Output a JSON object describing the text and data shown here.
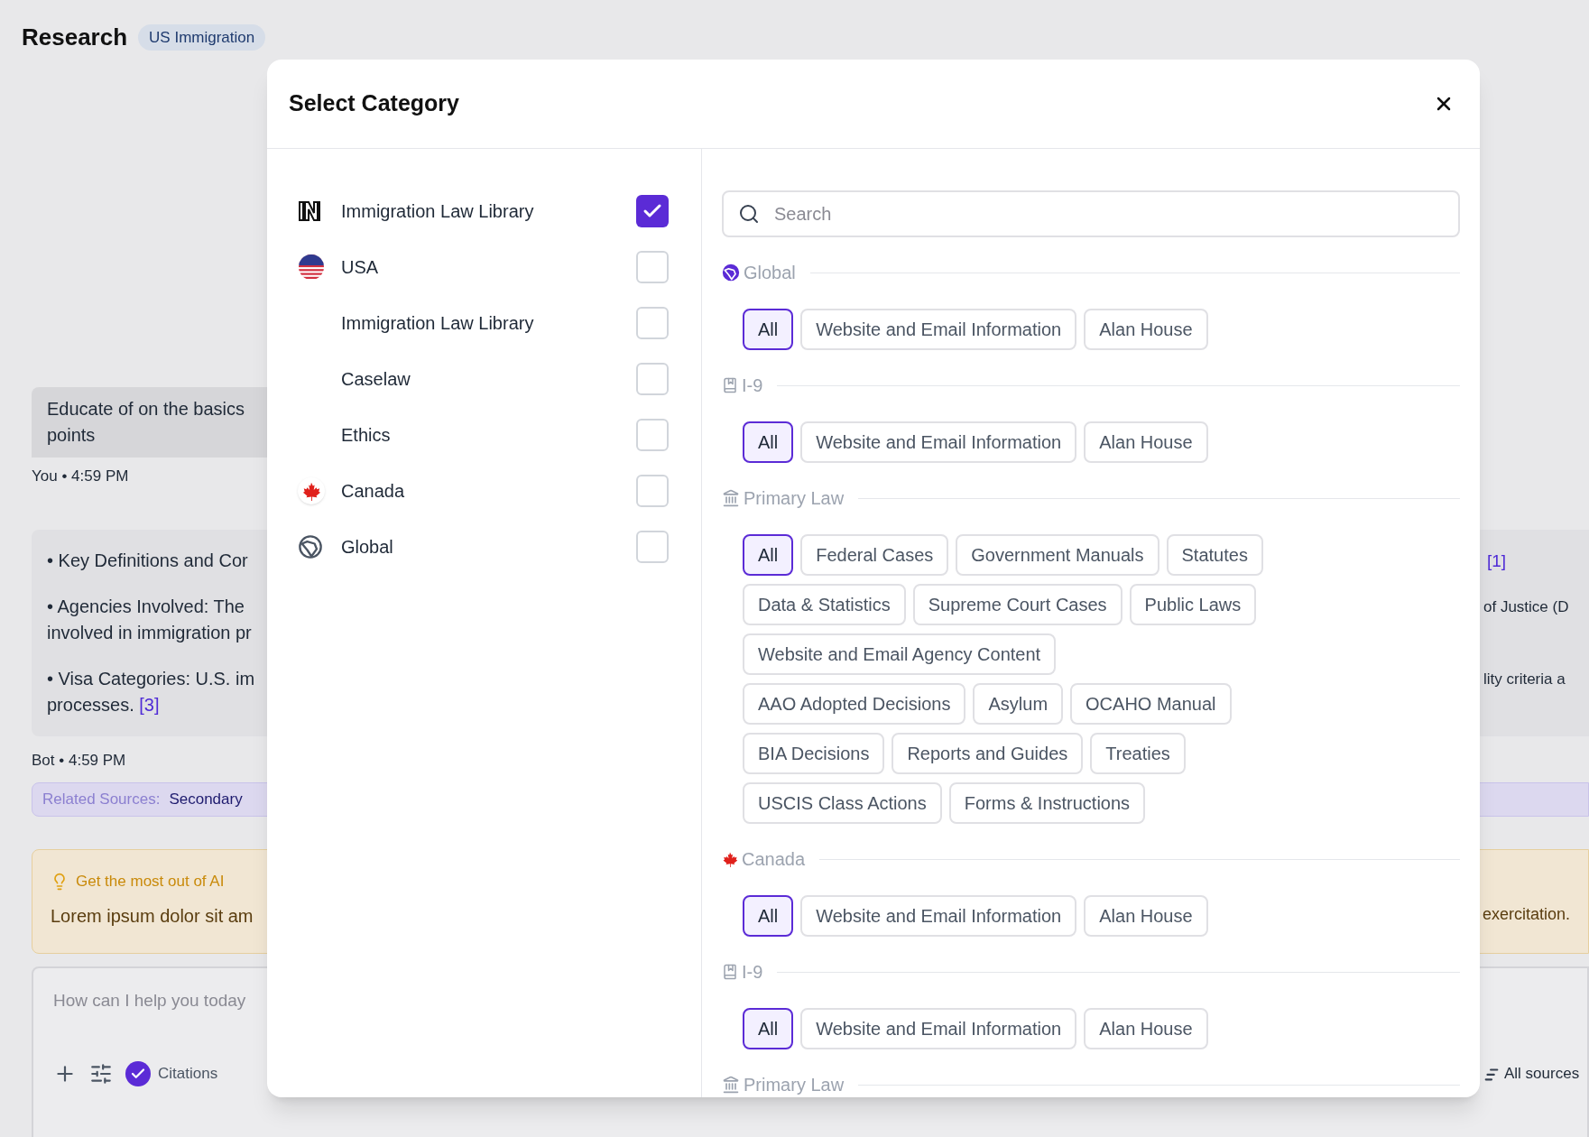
{
  "header": {
    "title": "Research",
    "badge": "US Immigration"
  },
  "user_message": {
    "lines": [
      "Educate of on the basics",
      "points"
    ],
    "sender": "You",
    "separator": "•",
    "time": "4:59 PM"
  },
  "bot_message": {
    "paragraphs": [
      {
        "left": [
          "• Key Definitions and Cor"
        ],
        "right_citation": "[1]"
      },
      {
        "left": [
          "• Agencies Involved: The",
          "involved in immigration pr"
        ],
        "right": "of Justice (D"
      },
      {
        "left": [
          "• Visa Categories: U.S. im",
          "processes."
        ],
        "citation": "[3]",
        "right": "lity criteria a"
      }
    ],
    "sender": "Bot",
    "separator": "•",
    "time": "4:59 PM"
  },
  "related_sources": {
    "label": "Related Sources:",
    "value": "Secondary"
  },
  "tip": {
    "title": "Get the most out of AI",
    "body": "Lorem ipsum dolor sit am",
    "body_right": "exercitation."
  },
  "composer": {
    "placeholder": "How can I help you today",
    "citations": {
      "label": "Citations",
      "checked": true
    },
    "sources_button": "All sources"
  },
  "modal": {
    "title": "Select Category",
    "categories": [
      {
        "label": "Immigration Law Library",
        "kind": "brand",
        "checked": true
      },
      {
        "label": "USA",
        "kind": "usa",
        "checked": false,
        "children": [
          {
            "label": "Immigration Law Library",
            "checked": false
          },
          {
            "label": "Caselaw",
            "checked": false
          },
          {
            "label": "Ethics",
            "checked": false
          }
        ]
      },
      {
        "label": "Canada",
        "kind": "canada",
        "checked": false
      },
      {
        "label": "Global",
        "kind": "global",
        "checked": false
      }
    ],
    "search": {
      "placeholder": "Search"
    },
    "sections": [
      {
        "title": "Global",
        "kind": "global",
        "chip_rows": [
          [
            {
              "label": "All",
              "selected": true
            },
            {
              "label": "Website and Email Information",
              "selected": false
            },
            {
              "label": "Alan House",
              "selected": false
            }
          ]
        ]
      },
      {
        "title": "I-9",
        "kind": "book",
        "chip_rows": [
          [
            {
              "label": "All",
              "selected": true
            },
            {
              "label": "Website and Email Information",
              "selected": false
            },
            {
              "label": "Alan House",
              "selected": false
            }
          ]
        ]
      },
      {
        "title": "Primary Law",
        "kind": "building",
        "chip_rows": [
          [
            {
              "label": "All",
              "selected": true
            },
            {
              "label": "Federal Cases",
              "selected": false
            },
            {
              "label": "Government Manuals",
              "selected": false
            },
            {
              "label": "Statutes",
              "selected": false
            }
          ],
          [
            {
              "label": "Data & Statistics",
              "selected": false
            },
            {
              "label": "Supreme Court Cases",
              "selected": false
            },
            {
              "label": "Public Laws",
              "selected": false
            }
          ],
          [
            {
              "label": "Website and Email Agency Content",
              "selected": false
            }
          ],
          [
            {
              "label": "AAO Adopted Decisions",
              "selected": false
            },
            {
              "label": "Asylum",
              "selected": false
            },
            {
              "label": "OCAHO Manual",
              "selected": false
            }
          ],
          [
            {
              "label": "BIA Decisions",
              "selected": false
            },
            {
              "label": "Reports and Guides",
              "selected": false
            },
            {
              "label": "Treaties",
              "selected": false
            }
          ],
          [
            {
              "label": "USCIS Class Actions",
              "selected": false
            },
            {
              "label": "Forms & Instructions",
              "selected": false
            }
          ]
        ]
      },
      {
        "title": "Canada",
        "kind": "canada",
        "chip_rows": [
          [
            {
              "label": "All",
              "selected": true
            },
            {
              "label": "Website and Email Information",
              "selected": false
            },
            {
              "label": "Alan House",
              "selected": false
            }
          ]
        ]
      },
      {
        "title": "I-9",
        "kind": "book",
        "chip_rows": [
          [
            {
              "label": "All",
              "selected": true
            },
            {
              "label": "Website and Email Information",
              "selected": false
            },
            {
              "label": "Alan House",
              "selected": false
            }
          ]
        ]
      },
      {
        "title": "Primary Law",
        "kind": "building"
      }
    ]
  }
}
